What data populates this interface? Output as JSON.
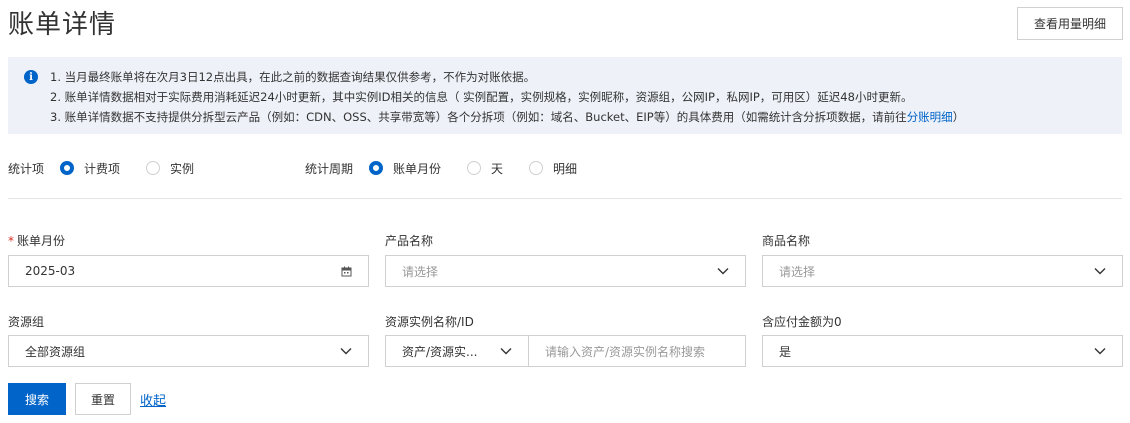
{
  "header": {
    "title": "账单详情",
    "usage_detail_label": "查看用量明细"
  },
  "notice": {
    "lines": [
      "1. 当月最终账单将在次月3日12点出具，在此之前的数据查询结果仅供参考，不作为对账依据。",
      "2. 账单详情数据相对于实际费用消耗延迟24小时更新，其中实例ID相关的信息（ 实例配置，实例规格，实例昵称，资源组，公网IP，私网IP，可用区）延迟48小时更新。",
      "3. 账单详情数据不支持提供分拆型云产品（例如：CDN、OSS、共享带宽等）各个分拆项（例如：域名、Bucket、EIP等）的具体费用（如需统计含分拆项数据，请前往"
    ],
    "line3_link": "分账明细",
    "line3_suffix": "）"
  },
  "stats": {
    "item_label": "统计项",
    "item_options": [
      "计费项",
      "实例"
    ],
    "period_label": "统计周期",
    "period_options": [
      "账单月份",
      "天",
      "明细"
    ]
  },
  "filters": {
    "billing_month": {
      "label": "账单月份",
      "value": "2025-03"
    },
    "product_name": {
      "label": "产品名称",
      "placeholder": "请选择"
    },
    "commodity_name": {
      "label": "商品名称",
      "placeholder": "请选择"
    },
    "resource_group": {
      "label": "资源组",
      "value": "全部资源组"
    },
    "instance": {
      "label": "资源实例名称/ID",
      "type_value": "资产/资源实...",
      "placeholder": "请输入资产/资源实例名称搜索"
    },
    "zero_amount": {
      "label": "含应付金额为0",
      "value": "是"
    }
  },
  "actions": {
    "search_label": "搜索",
    "reset_label": "重置",
    "collapse_label": "收起"
  },
  "colors": {
    "primary": "#0064c8",
    "notice_bg": "#eef2f8",
    "required": "#d93026"
  }
}
